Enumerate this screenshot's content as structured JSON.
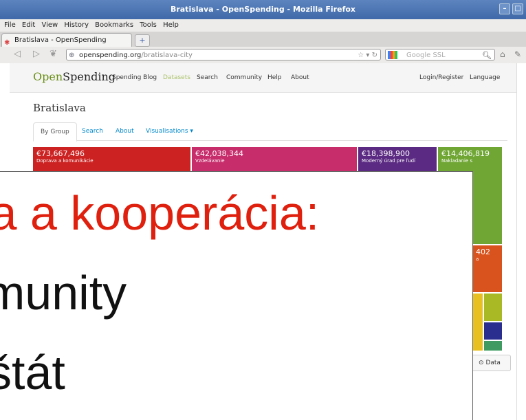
{
  "window": {
    "title": "Bratislava - OpenSpending - Mozilla Firefox"
  },
  "menu": [
    "File",
    "Edit",
    "View",
    "History",
    "Bookmarks",
    "Tools",
    "Help"
  ],
  "tab": {
    "title": "Bratislava - OpenSpending"
  },
  "url": {
    "host": "openspending.org",
    "path": "/bratislava-city"
  },
  "search": {
    "placeholder": "Google SSL"
  },
  "site": {
    "logo_open": "Open",
    "logo_spending": "Spending",
    "nav": [
      "Spending Blog",
      "Datasets",
      "Search",
      "Community",
      "Help",
      "About"
    ],
    "login": "Login/Register",
    "language": "Language"
  },
  "dataset": {
    "title": "Bratislava",
    "tabs": [
      "By Group",
      "Search",
      "About",
      "Visualisations ▾"
    ]
  },
  "treemap": [
    {
      "amount": "€73,667,496",
      "label": "Doprava a komunikácie",
      "color": "#cc2222"
    },
    {
      "amount": "€42,038,344",
      "label": "Vzdelávanie",
      "color": "#c72c6b"
    },
    {
      "amount": "€18,398,900",
      "label": "Moderný úrad pre ľudí",
      "color": "#5b2a82"
    },
    {
      "amount": "€14,406,819",
      "label": "Nakladanie s",
      "color": "#6fa634"
    },
    {
      "amount": "402",
      "label": "a",
      "color": "#d9531e"
    }
  ],
  "data_button": "Data",
  "overlay": {
    "line1": "ia a kooperácia:",
    "line2": "munity",
    "line3": "štát"
  }
}
